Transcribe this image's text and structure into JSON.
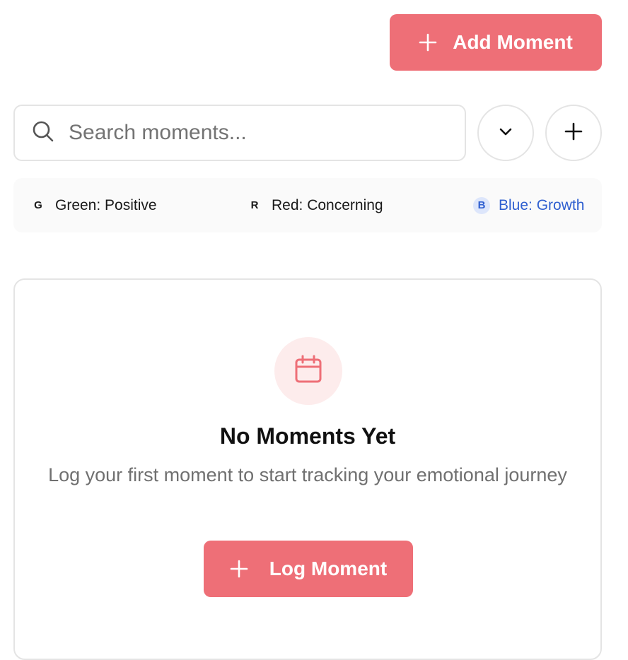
{
  "colors": {
    "accent": "#ee6f77",
    "positive": "#1a1a1a",
    "concerning": "#1a1a1a",
    "growth": "#2f5fd0"
  },
  "header": {
    "add_button_label": "Add Moment",
    "add_button_icon": "plus-icon"
  },
  "search": {
    "placeholder": "Search moments...",
    "value": "",
    "icon": "search-icon"
  },
  "actions": {
    "dropdown_icon": "chevron-down-icon",
    "add_icon": "plus-icon"
  },
  "legend": {
    "items": [
      {
        "badge": "G",
        "label": "Green: Positive"
      },
      {
        "badge": "R",
        "label": "Red: Concerning"
      },
      {
        "badge": "B",
        "label": "Blue: Growth"
      }
    ]
  },
  "empty_state": {
    "icon": "calendar-icon",
    "title": "No Moments Yet",
    "subtitle": "Log your first moment to start tracking your emotional journey",
    "button_label": "Log Moment",
    "button_icon": "plus-icon"
  }
}
